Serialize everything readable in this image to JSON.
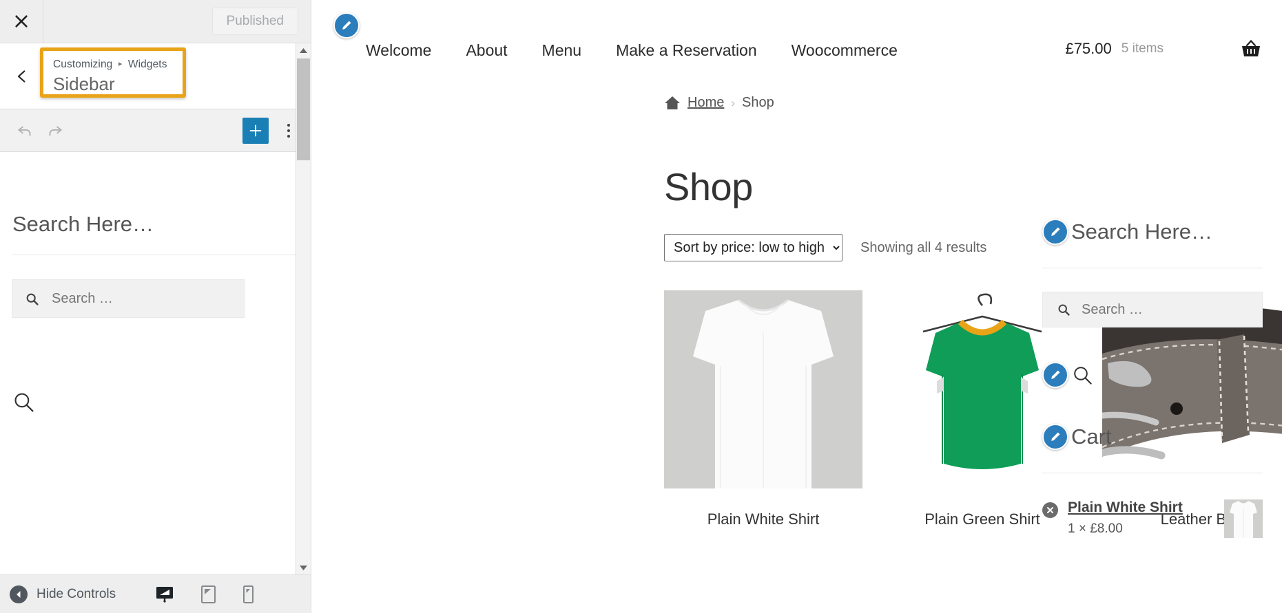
{
  "customizer": {
    "close_label": "Close",
    "publish_label": "Published",
    "breadcrumb_root": "Customizing",
    "breadcrumb_sep": "▸",
    "breadcrumb_parent": "Widgets",
    "section_title": "Sidebar",
    "back_label": "Back",
    "undo_label": "Undo",
    "redo_label": "Redo",
    "add_label": "+",
    "more_label": "More options",
    "highlight_color": "#e8a317",
    "accent_color": "#1a7fb5",
    "widget": {
      "heading": "Search Here…",
      "search_placeholder": "Search …"
    },
    "footer": {
      "hide_controls": "Hide Controls",
      "devices": [
        "desktop",
        "tablet",
        "mobile"
      ],
      "active_device": "desktop"
    }
  },
  "site": {
    "nav": [
      {
        "label": "Welcome"
      },
      {
        "label": "About"
      },
      {
        "label": "Menu"
      },
      {
        "label": "Make a Reservation"
      },
      {
        "label": "Woocommerce"
      }
    ],
    "cart_total": "£75.00",
    "cart_items": "5 items",
    "breadcrumb": {
      "home": "Home",
      "separator": "›",
      "current": "Shop"
    },
    "page_title": "Shop",
    "sort_selected": "Sort by price: low to high",
    "sort_options": [
      "Sort by price: low to high"
    ],
    "results_text": "Showing all 4 results",
    "products": [
      {
        "name": "Plain White Shirt"
      },
      {
        "name": "Plain Green Shirt"
      },
      {
        "name": "Leather Belt"
      }
    ],
    "sidebar": {
      "search_widget_title": "Search Here…",
      "search_placeholder": "Search …",
      "cart_widget_title": "Cart",
      "cart_line_name": "Plain White Shirt",
      "cart_line_qty": "1 × £8.00"
    }
  }
}
